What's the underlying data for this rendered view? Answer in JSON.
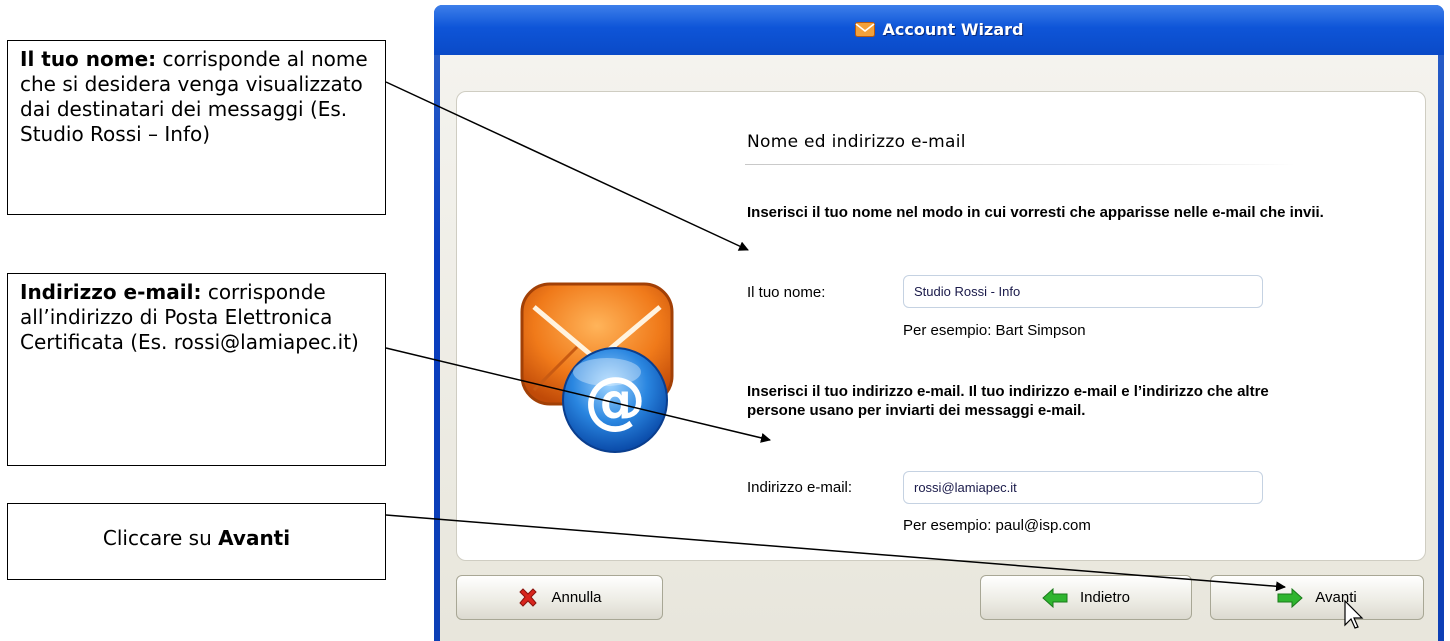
{
  "callouts": {
    "name": {
      "bold": "Il tuo nome:",
      "text": " corrisponde al nome che si desidera venga visualizzato dai destinatari dei messaggi (Es. Studio Rossi – Info)"
    },
    "email": {
      "bold": "Indirizzo e-mail:",
      "text": " corrisponde all’indirizzo di Posta Elettronica Certificata (Es. rossi@lamiapec.it)"
    },
    "next": {
      "text": "Cliccare su ",
      "bold": "Avanti"
    }
  },
  "window": {
    "title": "Account Wizard"
  },
  "page": {
    "heading": "Nome ed indirizzo e-mail",
    "name_instruction": "Inserisci il tuo nome nel modo in cui vorresti che apparisse nelle e-mail che invii.",
    "name_label": "Il tuo nome:",
    "name_value": "Studio Rossi - Info",
    "name_hint": "Per esempio: Bart Simpson",
    "email_instruction": "Inserisci il tuo indirizzo e-mail. Il tuo indirizzo e-mail e l’indirizzo che altre persone usano per inviarti dei messaggi e-mail.",
    "email_label": "Indirizzo e-mail:",
    "email_value": "rossi@lamiapec.it",
    "email_hint": "Per esempio: paul@isp.com"
  },
  "buttons": {
    "cancel": "Annulla",
    "back": "Indietro",
    "next": "Avanti"
  },
  "icons": {
    "title": "mail-icon",
    "main": "email-at-icon",
    "cancel": "red-x-icon",
    "back": "green-left-arrow-icon",
    "next": "green-right-arrow-icon",
    "cursor": "mouse-pointer-icon"
  },
  "colors": {
    "titlebar": "#0e55d8",
    "panel_bg": "#ffffff",
    "client_bg": "#ece9d8",
    "arrow_green": "#2fb52f",
    "cancel_red": "#d8251d"
  }
}
